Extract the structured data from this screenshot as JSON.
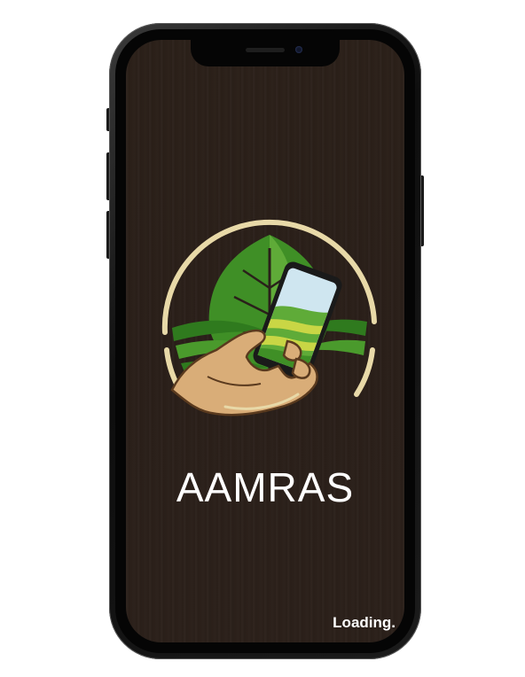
{
  "app": {
    "name": "AAMRAS",
    "status_text": "Loading."
  },
  "logo": {
    "icon": "farmer-hand-holding-phone-leaf-logo"
  },
  "colors": {
    "screen_background": "#2a201a",
    "ring": "#e8d9a8",
    "leaf_dark": "#2f7a1e",
    "leaf_light": "#6db33f",
    "skin": "#d9ad78",
    "text": "#ffffff"
  }
}
